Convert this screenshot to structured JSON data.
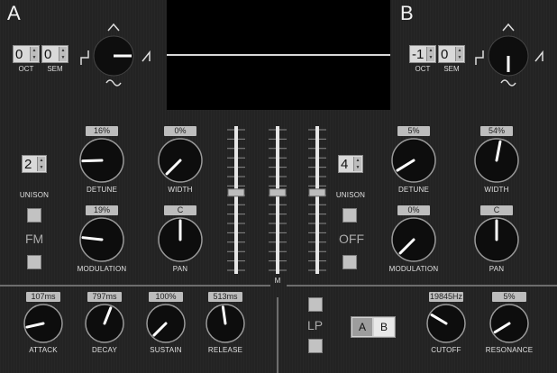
{
  "oscA": {
    "label": "A",
    "oct": {
      "value": "0",
      "label": "OCT"
    },
    "sem": {
      "value": "0",
      "label": "SEM"
    },
    "unison": {
      "value": "2",
      "label": "UNISON"
    },
    "mode_label": "FM",
    "knobs": {
      "detune": {
        "label": "DETUNE",
        "value": "16%",
        "level": 0.16
      },
      "width": {
        "label": "WIDTH",
        "value": "0%",
        "level": 0.0
      },
      "modulation": {
        "label": "MODULATION",
        "value": "19%",
        "level": 0.19
      },
      "pan": {
        "label": "PAN",
        "value": "C",
        "level": 0.5
      }
    }
  },
  "oscB": {
    "label": "B",
    "oct": {
      "value": "-1",
      "label": "OCT"
    },
    "sem": {
      "value": "0",
      "label": "SEM"
    },
    "unison": {
      "value": "4",
      "label": "UNISON"
    },
    "mode_label": "OFF",
    "knobs": {
      "detune": {
        "label": "DETUNE",
        "value": "5%",
        "level": 0.05
      },
      "width": {
        "label": "WIDTH",
        "value": "54%",
        "level": 0.54
      },
      "modulation": {
        "label": "MODULATION",
        "value": "0%",
        "level": 0.0
      },
      "pan": {
        "label": "PAN",
        "value": "C",
        "level": 0.5
      }
    }
  },
  "mixer": {
    "label": "M",
    "faders": [
      {
        "name": "A",
        "level": 0.55
      },
      {
        "name": "M",
        "level": 0.55
      },
      {
        "name": "B",
        "level": 0.55
      }
    ]
  },
  "envelope": {
    "attack": {
      "label": "ATTACK",
      "value": "107ms",
      "level": 0.12
    },
    "decay": {
      "label": "DECAY",
      "value": "797ms",
      "level": 0.58
    },
    "sustain": {
      "label": "SUSTAIN",
      "value": "100%",
      "level": 0.0
    },
    "release": {
      "label": "RELEASE",
      "value": "513ms",
      "level": 0.47
    }
  },
  "filter": {
    "mode_label": "LP",
    "route_buttons": [
      "A",
      "B"
    ],
    "active_route": "A",
    "cutoff": {
      "label": "CUTOFF",
      "value": "19845Hz",
      "level": 0.28
    },
    "resonance": {
      "label": "RESONANCE",
      "value": "5%",
      "level": 0.05
    }
  },
  "colors": {
    "background": "#232323",
    "knob": "#0d0d0d",
    "knob_ring": "#9a9a9a",
    "indicator": "#ffffff",
    "value_box": "#bdbdbd",
    "divider": "#6d6d6d"
  }
}
